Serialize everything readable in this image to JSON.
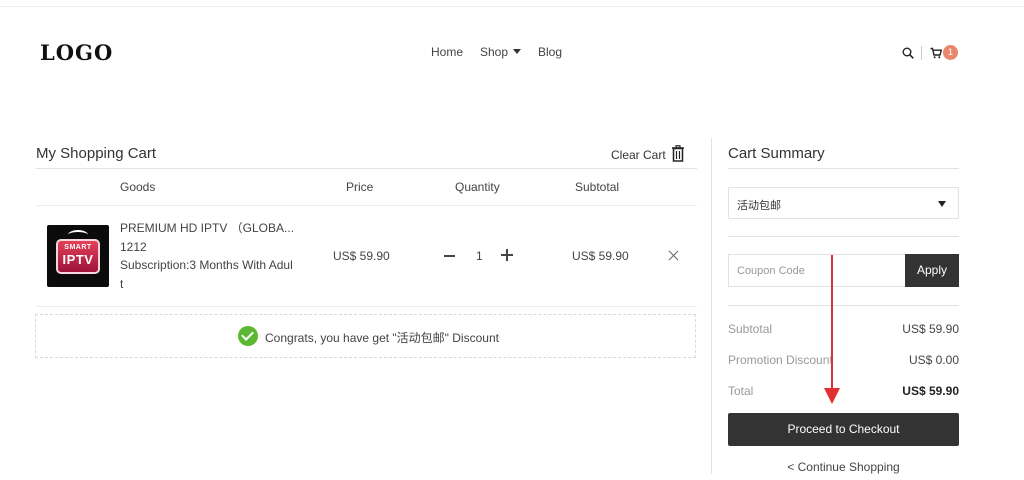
{
  "header": {
    "logo": "LOGO",
    "nav": {
      "home": "Home",
      "shop": "Shop",
      "blog": "Blog"
    },
    "cart_count": "1"
  },
  "cart": {
    "title": "My Shopping Cart",
    "clear_label": "Clear Cart",
    "columns": {
      "goods": "Goods",
      "price": "Price",
      "quantity": "Quantity",
      "subtotal": "Subtotal"
    },
    "items": [
      {
        "name": "PREMIUM HD IPTV （GLOBA... 1212",
        "subscription": "Subscription:3 Months With Adult",
        "thumb_text_top": "SMART",
        "thumb_text_main": "IPTV",
        "price": "US$ 59.90",
        "quantity": "1",
        "subtotal": "US$ 59.90"
      }
    ],
    "discount_message": "Congrats, you have get \"活动包邮\" Discount"
  },
  "summary": {
    "title": "Cart Summary",
    "shipping_option": "活动包邮",
    "coupon_placeholder": "Coupon Code",
    "apply_label": "Apply",
    "rows": {
      "subtotal_label": "Subtotal",
      "subtotal_value": "US$ 59.90",
      "promo_label": "Promotion Discount",
      "promo_value": "US$ 0.00",
      "total_label": "Total",
      "total_value": "US$ 59.90"
    },
    "checkout_label": "Proceed to Checkout",
    "continue_label": "< Continue Shopping"
  },
  "colors": {
    "dark_button": "#333333",
    "badge": "#e8876c",
    "success": "#5cb833",
    "annotation_arrow": "#e03030"
  }
}
